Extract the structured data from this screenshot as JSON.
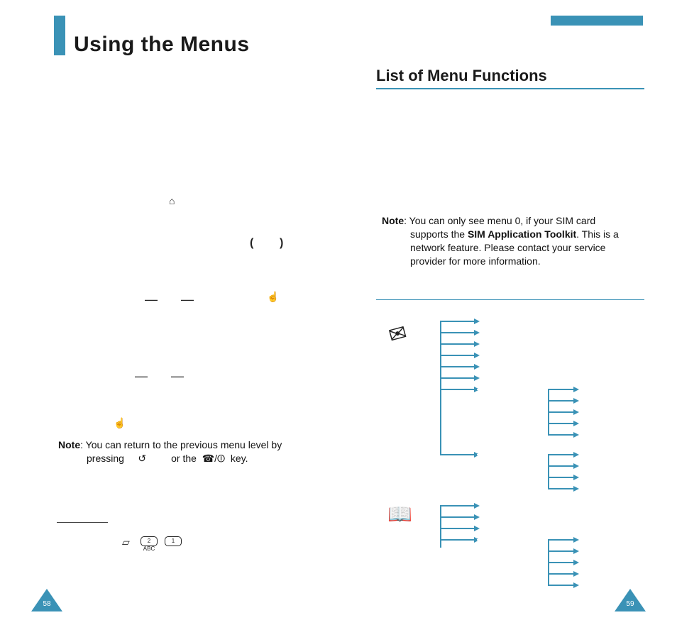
{
  "title": "Using the Menus",
  "subheading": "List of Menu Functions",
  "note_left": {
    "label": "Note",
    "line1": ": You can return to the previous menu level by",
    "line2_a": "pressing",
    "line2_b": "or the",
    "line2_c": "key."
  },
  "note_right": {
    "label": "Note",
    "line1": ": You can only see menu 0, if your SIM card",
    "line2_a": "supports the ",
    "bold": "SIM Application Toolkit",
    "line2_b": ". This is a",
    "line3": "network feature. Please contact your service",
    "line4": "provider for more information."
  },
  "keys": {
    "key2": "2 ABC",
    "key1": "1"
  },
  "icons": {
    "home": "⌂",
    "hand": "☝",
    "back": "↺",
    "phone": "☎/⏼",
    "envelope": "✉",
    "book": "📖"
  },
  "glyphs": {
    "paren_open": "(",
    "paren_close": ")",
    "dash": "—"
  },
  "page_left": "58",
  "page_right": "59"
}
